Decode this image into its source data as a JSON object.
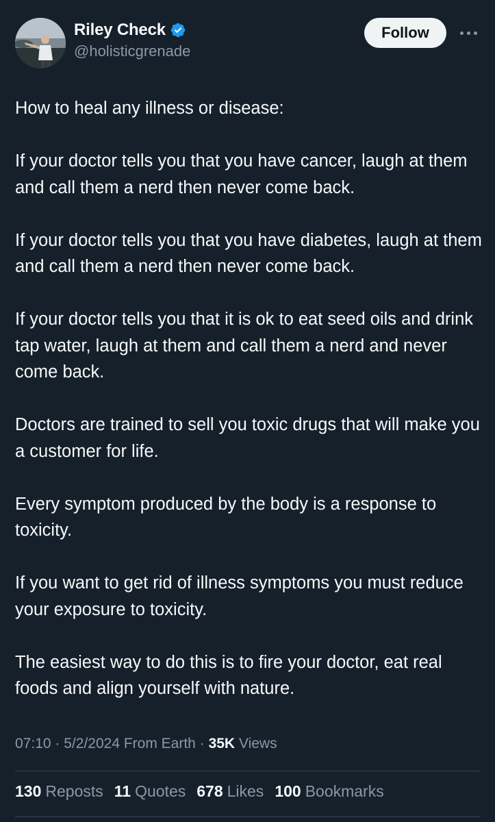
{
  "colors": {
    "background": "#15202b",
    "text_primary": "#f7f9f9",
    "text_secondary": "#8b98a5",
    "verified_badge": "#1d9bf0",
    "follow_button_bg": "#eff3f4",
    "divider": "#38444d"
  },
  "author": {
    "display_name": "Riley Check",
    "handle": "@holisticgrenade",
    "verified": true,
    "verified_icon": "verified-badge-icon",
    "avatar_icon": "profile-photo"
  },
  "actions": {
    "follow_label": "Follow",
    "more_icon": "more-horizontal-icon"
  },
  "tweet": {
    "paragraphs": [
      "How to heal any illness or disease:",
      "If your doctor tells you that you have cancer, laugh at them and call them a nerd then never come back.",
      "If your doctor tells you that you have diabetes, laugh at them and call them a nerd then never come back.",
      "If your doctor tells you that it is ok to eat seed oils and drink tap water, laugh at them and call them a nerd and never come back.",
      "Doctors are trained to sell you toxic drugs that will make you a customer for life.",
      "Every symptom produced by the body is a response to toxicity.",
      "If you want to get rid of illness symptoms you must reduce your exposure to toxicity.",
      "The easiest way to do this is to fire your doctor, eat real foods and align yourself with nature."
    ]
  },
  "meta": {
    "time": "07:10",
    "separator": "·",
    "date": "5/2/2024",
    "source": "From Earth",
    "views_count": "35K",
    "views_label": "Views"
  },
  "stats": {
    "reposts": {
      "count": "130",
      "label": "Reposts"
    },
    "quotes": {
      "count": "11",
      "label": "Quotes"
    },
    "likes": {
      "count": "678",
      "label": "Likes"
    },
    "bookmarks": {
      "count": "100",
      "label": "Bookmarks"
    }
  }
}
